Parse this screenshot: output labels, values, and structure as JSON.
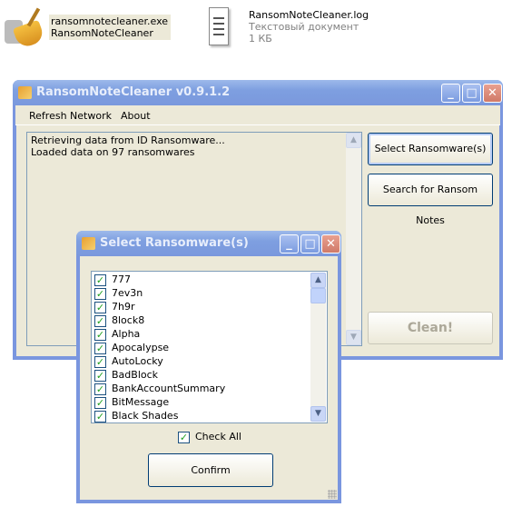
{
  "desktop": {
    "files": [
      {
        "name": "ransomnotecleaner.exe",
        "desc": "RansomNoteCleaner",
        "icon": "broom-icon"
      },
      {
        "name": "RansomNoteCleaner.log",
        "type": "Текстовый документ",
        "size": "1 КБ",
        "icon": "text-document-icon"
      }
    ]
  },
  "main": {
    "title": "RansomNoteCleaner v0.9.1.2",
    "menu": [
      "Refresh Network",
      "About"
    ],
    "log": [
      "Retrieving data from ID Ransomware...",
      "Loaded data on 97 ransomwares"
    ],
    "buttons": {
      "select": "Select Ransomware(s)",
      "search": "Search for Ransom Notes",
      "clean": "Clean!"
    }
  },
  "dialog": {
    "title": "Select Ransomware(s)",
    "items": [
      "777",
      "7ev3n",
      "7h9r",
      "8lock8",
      "Alpha",
      "Apocalypse",
      "AutoLocky",
      "BadBlock",
      "BankAccountSummary",
      "BitMessage",
      "Black Shades"
    ],
    "check_all": "Check All",
    "confirm": "Confirm"
  },
  "colors": {
    "titlebar": "#7e9fe0",
    "border": "#0831d9",
    "face": "#ece9d8",
    "check": "#21a121"
  }
}
